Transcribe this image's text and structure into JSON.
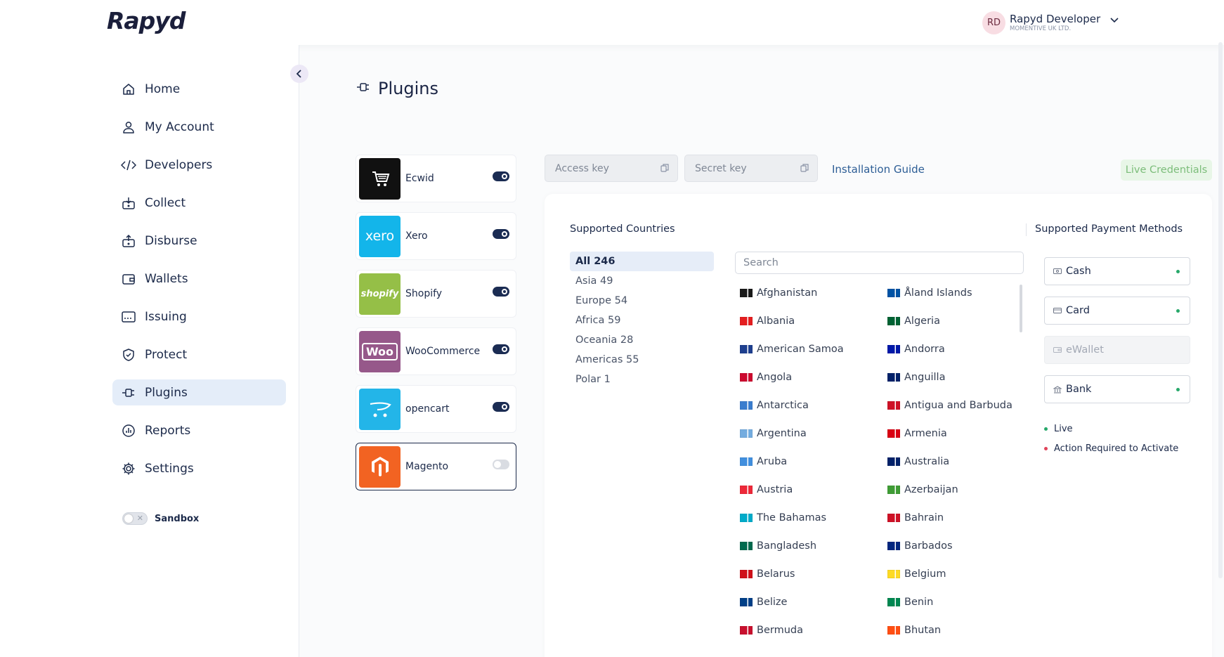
{
  "header": {
    "logo": "Rapyd",
    "user_initials": "RD",
    "user_name": "Rapyd Developer",
    "user_org": "MOMENTIVE UK LTD."
  },
  "sidebar": {
    "items": [
      {
        "label": "Home",
        "icon": "home-icon"
      },
      {
        "label": "My Account",
        "icon": "user-icon"
      },
      {
        "label": "Developers",
        "icon": "code-icon"
      },
      {
        "label": "Collect",
        "icon": "collect-icon"
      },
      {
        "label": "Disburse",
        "icon": "disburse-icon"
      },
      {
        "label": "Wallets",
        "icon": "wallet-icon"
      },
      {
        "label": "Issuing",
        "icon": "card-icon"
      },
      {
        "label": "Protect",
        "icon": "shield-icon"
      },
      {
        "label": "Plugins",
        "icon": "plug-icon",
        "active": true
      },
      {
        "label": "Reports",
        "icon": "chart-icon"
      },
      {
        "label": "Settings",
        "icon": "gear-icon"
      }
    ],
    "sandbox_label": "Sandbox"
  },
  "main": {
    "title": "Plugins",
    "plugins": [
      {
        "name": "Ecwid",
        "logo_color": "#111111",
        "enabled": true
      },
      {
        "name": "Xero",
        "logo_color": "#13b5ea",
        "logo_text": "xero",
        "enabled": true
      },
      {
        "name": "Shopify",
        "logo_color": "#95bf47",
        "logo_text": "shopify",
        "enabled": true
      },
      {
        "name": "WooCommerce",
        "logo_color": "#96588a",
        "logo_text": "Woo",
        "enabled": true
      },
      {
        "name": "opencart",
        "logo_color": "#23b5e8",
        "enabled": true
      },
      {
        "name": "Magento",
        "logo_color": "#f26322",
        "enabled": false,
        "selected": true
      }
    ],
    "access_key_placeholder": "Access key",
    "secret_key_placeholder": "Secret key",
    "installation_guide": "Installation Guide",
    "live_credentials": "Live Credentials",
    "supported_countries_title": "Supported Countries",
    "supported_methods_title": "Supported Payment Methods",
    "regions": [
      "All 246",
      "Asia 49",
      "Europe 54",
      "Africa 59",
      "Oceania 28",
      "Americas 55",
      "Polar 1"
    ],
    "search_placeholder": "Search",
    "countries_col1": [
      "Afghanistan",
      "Albania",
      "American Samoa",
      "Angola",
      "Antarctica",
      "Argentina",
      "Aruba",
      "Austria",
      "The Bahamas",
      "Bangladesh",
      "Belarus",
      "Belize",
      "Bermuda"
    ],
    "countries_col2": [
      "Åland Islands",
      "Algeria",
      "Andorra",
      "Anguilla",
      "Antigua and Barbuda",
      "Armenia",
      "Australia",
      "Azerbaijan",
      "Bahrain",
      "Barbados",
      "Belgium",
      "Benin",
      "Bhutan"
    ],
    "flag_colors_col1": [
      "#1a1a1a",
      "#e41e20",
      "#1e3f8f",
      "#cc092f",
      "#3a7dce",
      "#74acdf",
      "#418fde",
      "#ed2939",
      "#00abc9",
      "#006a4e",
      "#cf101a",
      "#003f87",
      "#c8102e"
    ],
    "flag_colors_col2": [
      "#0053a5",
      "#006233",
      "#0018a8",
      "#012169",
      "#ce1126",
      "#d90012",
      "#012169",
      "#3f9c35",
      "#ce1126",
      "#00267f",
      "#fdda24",
      "#008751",
      "#ff4e12"
    ],
    "payment_methods": [
      {
        "label": "Cash",
        "active": true,
        "icon": "cash-icon"
      },
      {
        "label": "Card",
        "active": true,
        "icon": "card-icon"
      },
      {
        "label": "eWallet",
        "active": false,
        "icon": "ewallet-icon"
      },
      {
        "label": "Bank",
        "active": true,
        "icon": "bank-icon"
      }
    ],
    "legend": [
      {
        "label": "Live",
        "color": "#27a86a"
      },
      {
        "label": "Action Required to Activate",
        "color": "#e0445a"
      }
    ]
  }
}
